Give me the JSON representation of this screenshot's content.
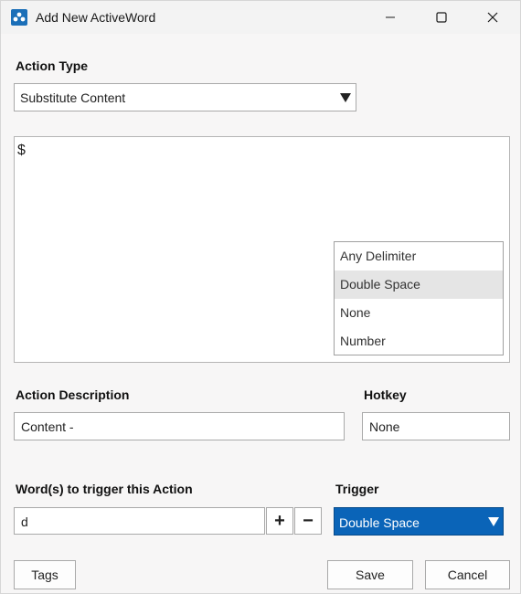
{
  "window": {
    "title": "Add New ActiveWord"
  },
  "action_type": {
    "label": "Action Type",
    "selected": "Substitute Content"
  },
  "editor": {
    "content": "$"
  },
  "delimiter_list": {
    "items": [
      "Any Delimiter",
      "Double Space",
      "None",
      "Number"
    ],
    "selected": "Double Space"
  },
  "description": {
    "label": "Action Description",
    "value": "Content -"
  },
  "hotkey": {
    "label": "Hotkey",
    "value": "None"
  },
  "trigger_words": {
    "label": "Word(s) to trigger this Action",
    "value": "d",
    "add_label": "+",
    "remove_label": "−"
  },
  "trigger": {
    "label": "Trigger",
    "selected": "Double Space"
  },
  "buttons": {
    "tags": "Tags",
    "save": "Save",
    "cancel": "Cancel"
  },
  "colors": {
    "accent": "#0a64b8",
    "selection": "#e5e5e5"
  }
}
